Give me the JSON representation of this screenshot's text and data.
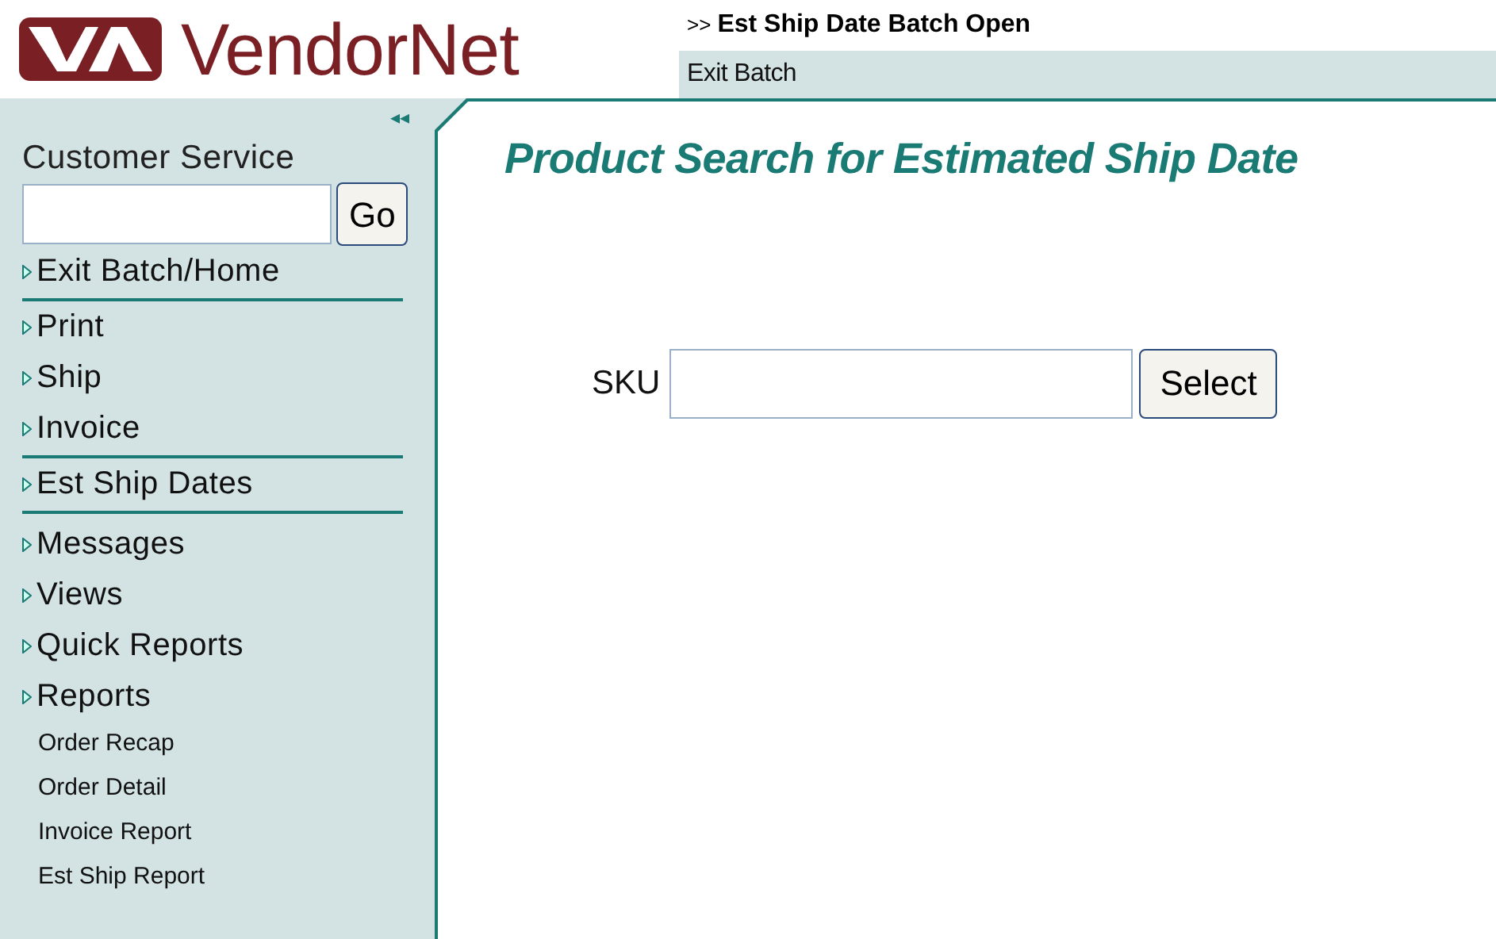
{
  "logo": {
    "name": "VendorNet"
  },
  "header": {
    "breadcrumb_prefix": ">>",
    "breadcrumb": "Est Ship Date Batch Open",
    "link": "Exit Batch"
  },
  "sidebar": {
    "collapse": "◂◂",
    "search_label": "Customer Service",
    "go_button": "Go",
    "sections": [
      [
        {
          "label": "Exit Batch/Home",
          "kind": "main"
        }
      ],
      [
        {
          "label": "Print",
          "kind": "main"
        },
        {
          "label": "Ship",
          "kind": "main"
        },
        {
          "label": "Invoice",
          "kind": "main"
        }
      ],
      [
        {
          "label": "Est Ship Dates",
          "kind": "main"
        }
      ],
      [
        {
          "label": "Messages",
          "kind": "main"
        },
        {
          "label": "Views",
          "kind": "main"
        },
        {
          "label": "Quick Reports",
          "kind": "main"
        },
        {
          "label": "Reports",
          "kind": "main"
        },
        {
          "label": "Order Recap",
          "kind": "sub"
        },
        {
          "label": "Order Detail",
          "kind": "sub"
        },
        {
          "label": "Invoice Report",
          "kind": "sub"
        },
        {
          "label": "Est Ship Report",
          "kind": "sub"
        }
      ]
    ]
  },
  "main": {
    "title": "Product Search for Estimated Ship Date",
    "sku_label": "SKU",
    "select_button": "Select"
  }
}
